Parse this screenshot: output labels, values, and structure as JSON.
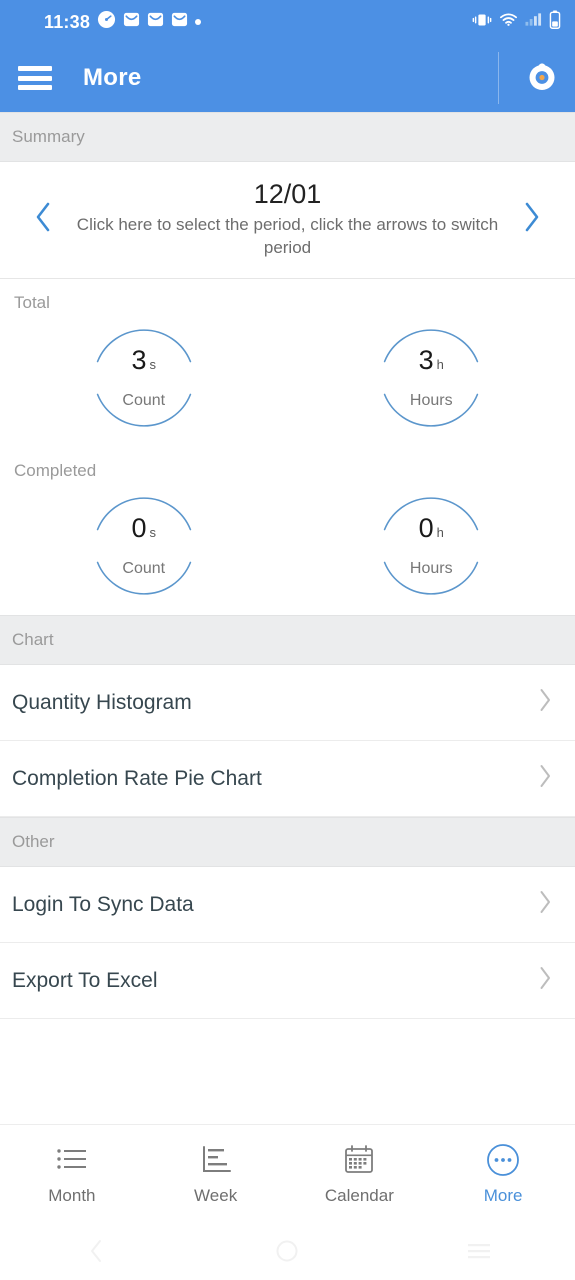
{
  "statusbar": {
    "time": "11:38",
    "left_icons": [
      "clock-icon",
      "mail-icon",
      "mail-icon",
      "mail-icon",
      "dot-indicator-icon"
    ],
    "right_icons": [
      "vibrate-icon",
      "wifi-icon",
      "signal-icon",
      "battery-icon"
    ]
  },
  "appbar": {
    "title": "More",
    "menu_icon": "hamburger-menu-icon",
    "action_icon": "timer-icon"
  },
  "sections": {
    "summary_header": "Summary",
    "chart_header": "Chart",
    "other_header": "Other"
  },
  "period": {
    "value": "12/01",
    "hint": "Click here to select the period, click the arrows to switch period",
    "prev_icon": "chevron-left-icon",
    "next_icon": "chevron-right-icon"
  },
  "summary": {
    "total": {
      "label": "Total",
      "gauges": [
        {
          "value": "3",
          "unit": "s",
          "label": "Count"
        },
        {
          "value": "3",
          "unit": "h",
          "label": "Hours"
        }
      ]
    },
    "completed": {
      "label": "Completed",
      "gauges": [
        {
          "value": "0",
          "unit": "s",
          "label": "Count"
        },
        {
          "value": "0",
          "unit": "h",
          "label": "Hours"
        }
      ]
    }
  },
  "chart_rows": [
    {
      "label": "Quantity Histogram",
      "chevron": "chevron-right-icon"
    },
    {
      "label": "Completion Rate Pie Chart",
      "chevron": "chevron-right-icon"
    }
  ],
  "other_rows": [
    {
      "label": "Login To Sync Data",
      "chevron": "chevron-right-icon"
    },
    {
      "label": "Export To Excel",
      "chevron": "chevron-right-icon"
    }
  ],
  "tabs": [
    {
      "label": "Month",
      "icon": "list-icon",
      "active": false
    },
    {
      "label": "Week",
      "icon": "bar-chart-icon",
      "active": false
    },
    {
      "label": "Calendar",
      "icon": "calendar-icon",
      "active": false
    },
    {
      "label": "More",
      "icon": "ellipsis-circle-icon",
      "active": true
    }
  ],
  "navbar": {
    "back_icon": "back-icon",
    "home_icon": "home-icon",
    "recents_icon": "recents-icon"
  },
  "colors": {
    "accent": "#4c90e4",
    "ring": "#5b96cc",
    "section_bg": "#ecedee",
    "chevron": "#bdbdbd"
  }
}
